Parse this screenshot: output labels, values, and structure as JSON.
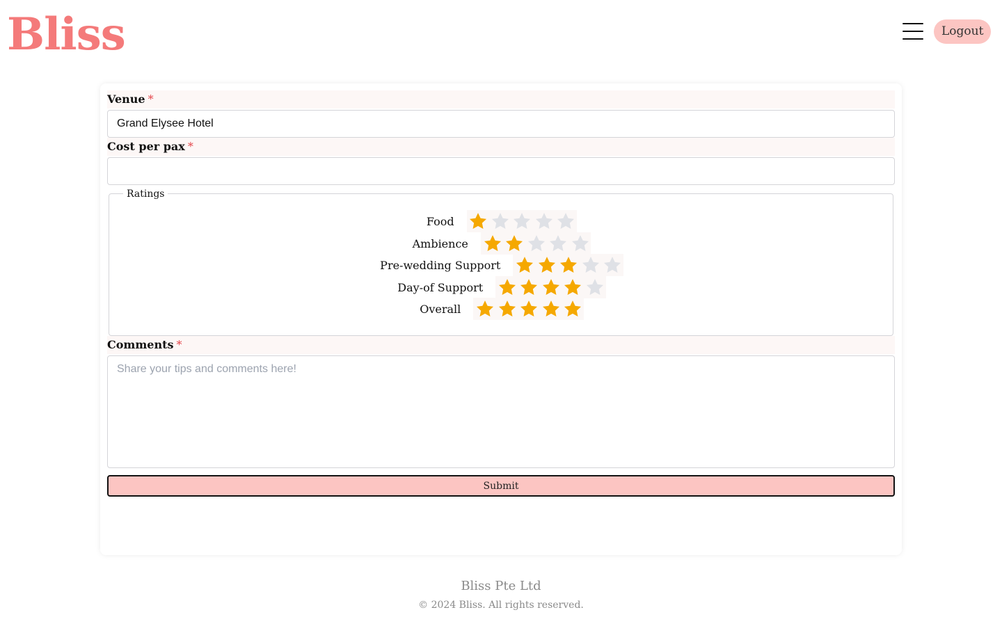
{
  "header": {
    "logo": "Bliss",
    "menu_icon": "hamburger-menu-icon",
    "logout_label": "Logout"
  },
  "colors": {
    "brand": "#f47a7a",
    "accent_pink": "#fcc5c2",
    "star_filled": "#f5a800",
    "star_empty": "#dfe1e6",
    "required": "#e5484d"
  },
  "form": {
    "venue": {
      "label": "Venue",
      "required_mark": "*",
      "value": "Grand Elysee Hotel"
    },
    "cost": {
      "label": "Cost per pax",
      "required_mark": "*",
      "value": "",
      "placeholder": ""
    },
    "ratings": {
      "legend": "Ratings",
      "max_stars": 5,
      "items": [
        {
          "label": "Food",
          "value": 1
        },
        {
          "label": "Ambience",
          "value": 2
        },
        {
          "label": "Pre-wedding Support",
          "value": 3
        },
        {
          "label": "Day-of Support",
          "value": 4
        },
        {
          "label": "Overall",
          "value": 5
        }
      ]
    },
    "comments": {
      "label": "Comments",
      "required_mark": "*",
      "value": "",
      "placeholder": "Share your tips and comments here!"
    },
    "submit_label": "Submit"
  },
  "footer": {
    "company": "Bliss Pte Ltd",
    "copyright": "© 2024 Bliss. All rights reserved."
  }
}
